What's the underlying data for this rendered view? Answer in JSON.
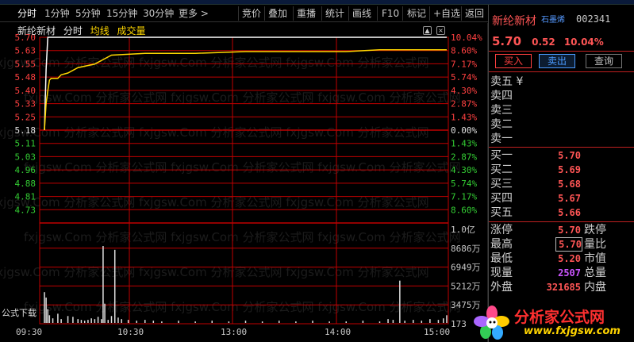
{
  "toolbar": {
    "items": [
      "分时",
      "1分钟",
      "5分钟",
      "15分钟",
      "30分钟",
      "更多 >",
      "竞价",
      "叠加",
      "重播",
      "统计",
      "画线",
      "F10",
      "标记",
      "+自选",
      "返回"
    ]
  },
  "chart": {
    "stock_name": "新纶新材",
    "mode": "分时",
    "avg_label": "均线",
    "vol_label": "成交量",
    "colors": {
      "up": "#ff4040",
      "down": "#33cc33",
      "flat": "#e0e0e0",
      "price_line": "#ffffff",
      "avg_line": "#ffd700",
      "grid": "#c00000"
    },
    "watermark": "fxjgsw.Com 分析家公式网"
  },
  "chart_data": {
    "type": "line",
    "prev_close": 5.18,
    "price_ticks": [
      "5.70",
      "5.63",
      "5.55",
      "5.48",
      "5.40",
      "5.33",
      "5.25",
      "5.18",
      "5.11",
      "5.03",
      "4.96",
      "4.88",
      "4.81",
      "4.73"
    ],
    "pct_ticks": [
      "10.04%",
      "8.60%",
      "7.17%",
      "5.74%",
      "4.30%",
      "2.87%",
      "1.43%",
      "0.00%",
      "1.43%",
      "2.87%",
      "4.30%",
      "5.74%",
      "7.17%",
      "8.60%"
    ],
    "volume_ticks": [
      "1.0亿",
      "8686万",
      "6949万",
      "5212万",
      "3475万",
      "173"
    ],
    "time_ticks": [
      "09:30",
      "10:30",
      "13:00",
      "14:00",
      "15:00"
    ],
    "ylim": [
      4.66,
      5.7
    ],
    "price_series": [
      [
        0,
        5.18
      ],
      [
        1,
        5.52
      ],
      [
        2,
        5.7
      ],
      [
        3,
        5.7
      ],
      [
        240,
        5.7
      ]
    ],
    "avg_series": [
      [
        0,
        5.18
      ],
      [
        1,
        5.33
      ],
      [
        2,
        5.4
      ],
      [
        3,
        5.46
      ],
      [
        4,
        5.47
      ],
      [
        5,
        5.47
      ],
      [
        8,
        5.47
      ],
      [
        10,
        5.49
      ],
      [
        14,
        5.5
      ],
      [
        20,
        5.53
      ],
      [
        30,
        5.55
      ],
      [
        40,
        5.6
      ],
      [
        60,
        5.61
      ],
      [
        90,
        5.61
      ],
      [
        120,
        5.62
      ],
      [
        150,
        5.62
      ],
      [
        180,
        5.62
      ],
      [
        200,
        5.63
      ],
      [
        240,
        5.63
      ]
    ],
    "volume_bars": [
      [
        0,
        0.4
      ],
      [
        1,
        0.33
      ],
      [
        2,
        0.18
      ],
      [
        3,
        0.1
      ],
      [
        5,
        0.06
      ],
      [
        8,
        0.12
      ],
      [
        10,
        0.05
      ],
      [
        14,
        0.09
      ],
      [
        17,
        0.08
      ],
      [
        20,
        0.05
      ],
      [
        22,
        0.04
      ],
      [
        24,
        0.03
      ],
      [
        26,
        0.04
      ],
      [
        28,
        0.06
      ],
      [
        30,
        0.05
      ],
      [
        32,
        0.08
      ],
      [
        34,
        0.05
      ],
      [
        35,
        1.0
      ],
      [
        36,
        0.25
      ],
      [
        38,
        0.04
      ],
      [
        40,
        0.09
      ],
      [
        42,
        0.95
      ],
      [
        44,
        0.07
      ],
      [
        46,
        0.05
      ],
      [
        50,
        0.04
      ],
      [
        55,
        0.03
      ],
      [
        60,
        0.04
      ],
      [
        65,
        0.03
      ],
      [
        70,
        0.02
      ],
      [
        80,
        0.03
      ],
      [
        90,
        0.02
      ],
      [
        100,
        0.03
      ],
      [
        110,
        0.02
      ],
      [
        120,
        0.03
      ],
      [
        130,
        0.02
      ],
      [
        140,
        0.03
      ],
      [
        150,
        0.02
      ],
      [
        160,
        0.03
      ],
      [
        170,
        0.02
      ],
      [
        180,
        0.02
      ],
      [
        190,
        0.03
      ],
      [
        200,
        0.02
      ],
      [
        205,
        0.05
      ],
      [
        208,
        0.04
      ],
      [
        212,
        0.55
      ],
      [
        215,
        0.03
      ],
      [
        220,
        0.04
      ],
      [
        225,
        0.03
      ],
      [
        230,
        0.05
      ],
      [
        235,
        0.04
      ],
      [
        238,
        0.06
      ],
      [
        240,
        0.1
      ]
    ]
  },
  "panel": {
    "name": "新纶新材",
    "badge": "石墨烯",
    "code": "002341",
    "price": "5.70",
    "change": "0.52",
    "pct": "10.04%",
    "buy_btn": "买入",
    "sell_btn": "卖出",
    "query_btn": "查询",
    "ask": [
      {
        "label": "卖五 ¥",
        "value": ""
      },
      {
        "label": "卖四",
        "value": ""
      },
      {
        "label": "卖三",
        "value": ""
      },
      {
        "label": "卖二",
        "value": ""
      },
      {
        "label": "卖一",
        "value": ""
      }
    ],
    "bid": [
      {
        "label": "买一",
        "value": "5.70"
      },
      {
        "label": "买二",
        "value": "5.69"
      },
      {
        "label": "买三",
        "value": "5.68"
      },
      {
        "label": "买四",
        "value": "5.67"
      },
      {
        "label": "买五",
        "value": "5.66"
      }
    ],
    "stats": [
      {
        "label": "涨停",
        "value": "5.70",
        "label2": "跌停",
        "color": "#ff5555"
      },
      {
        "label": "最高",
        "value": "5.70",
        "label2": "量比",
        "color": "#ff5555"
      },
      {
        "label": "最低",
        "value": "5.20",
        "label2": "市值",
        "color": "#ff5555"
      },
      {
        "label": "现量",
        "value": "2507",
        "label2": "总量",
        "color": "#cc55ff"
      },
      {
        "label": "外盘",
        "value": "321685",
        "label2": "内盘",
        "color": "#ff5555"
      }
    ]
  },
  "logo": {
    "text": "分析家公式网",
    "url": "www.fxjgsw.com"
  },
  "formula_tag": "公式下载"
}
